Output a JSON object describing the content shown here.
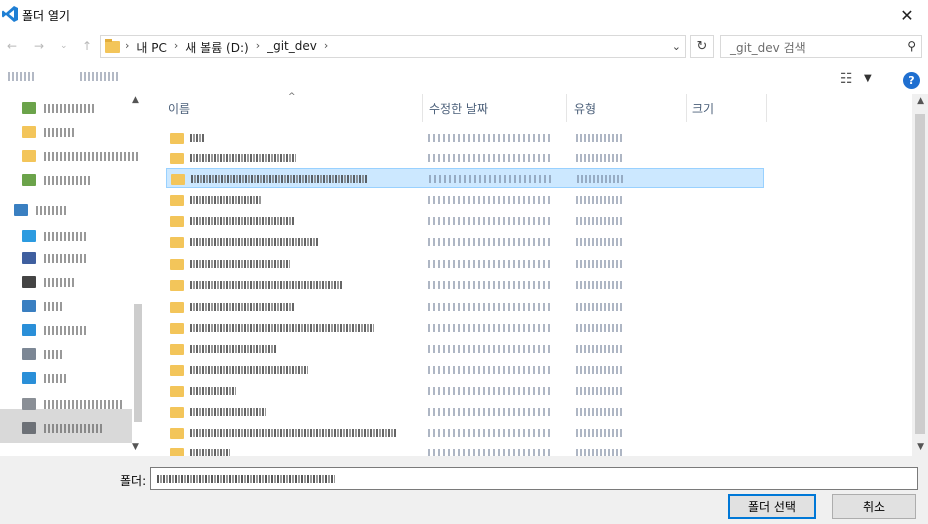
{
  "window": {
    "title": "폴더 열기",
    "close_glyph": "✕"
  },
  "navigation": {
    "back_glyph": "←",
    "forward_glyph": "→",
    "up_glyph": "↑",
    "breadcrumbs": [
      "내 PC",
      "새 볼륨 (D:)",
      "_git_dev"
    ],
    "crumb_separator": "›",
    "dropdown_glyph": "⌄",
    "refresh_glyph": "↻",
    "search_placeholder": "_git_dev 검색",
    "search_glyph": "⚲"
  },
  "toolbar": {
    "view_glyph": "☷",
    "view_dropdown_glyph": "▼",
    "help_glyph": "?"
  },
  "columns": {
    "name": "이름",
    "date": "수정한 날짜",
    "type": "유형",
    "size": "크기",
    "sort_glyph": "^"
  },
  "footer": {
    "folder_label": "폴더:",
    "select_button": "폴더 선택",
    "cancel_button": "취소"
  },
  "colors": {
    "accent": "#0078d7",
    "selection": "#cce8ff",
    "folder": "#f3c55a"
  }
}
